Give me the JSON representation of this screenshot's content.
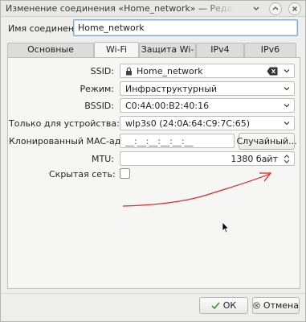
{
  "window": {
    "title": "Изменение соединения «Home_network» — Редактор соединений"
  },
  "connection_name": {
    "label": "Имя соединения:",
    "value": "Home_network"
  },
  "tabs": [
    {
      "label": "Основные параметры",
      "active": false
    },
    {
      "label": "Wi-Fi",
      "active": true
    },
    {
      "label": "Защита Wi-Fi",
      "active": false
    },
    {
      "label": "IPv4",
      "active": false
    },
    {
      "label": "IPv6",
      "active": false
    }
  ],
  "wifi": {
    "ssid_label": "SSID:",
    "ssid_value": "Home_network",
    "mode_label": "Режим:",
    "mode_value": "Инфраструктурный",
    "bssid_label": "BSSID:",
    "bssid_value": "C0:4A:00:B2:40:16",
    "device_label": "Только для устройства:",
    "device_value": "wlp3s0 (24:0A:64:C9:7C:65)",
    "cloned_mac_label": "Клонированный MAC-адрес:",
    "cloned_mac_value": "__:__:__:__:__:__",
    "random_button": "Случайный...",
    "mtu_label": "MTU:",
    "mtu_value": "1380 байт",
    "hidden_label": "Скрытая сеть:",
    "hidden_checked": false
  },
  "buttons": {
    "ok": "ОК",
    "cancel": "Отмена"
  },
  "colors": {
    "annotation": "#e02020",
    "ok_icon": "#4a8a3a",
    "cancel_icon": "#555555"
  }
}
